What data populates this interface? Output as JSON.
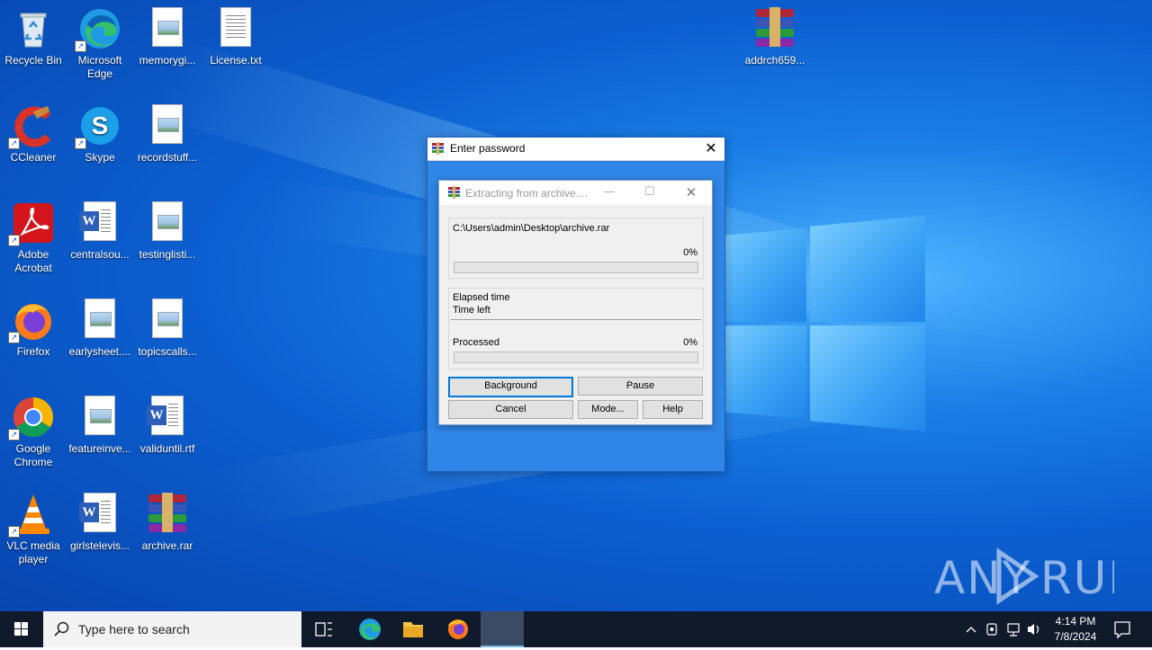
{
  "desktop": {
    "icons": [
      {
        "label": "Recycle Bin"
      },
      {
        "label": "Microsoft Edge"
      },
      {
        "label": "memorygi..."
      },
      {
        "label": "License.txt"
      },
      {
        "label": "addrch659..."
      },
      {
        "label": "CCleaner"
      },
      {
        "label": "Skype"
      },
      {
        "label": "recordstuff..."
      },
      {
        "label": "Adobe Acrobat"
      },
      {
        "label": "centralsou..."
      },
      {
        "label": "testinglisti..."
      },
      {
        "label": "Firefox"
      },
      {
        "label": "earlysheet...."
      },
      {
        "label": "topicscalls..."
      },
      {
        "label": "Google Chrome"
      },
      {
        "label": "featureinve..."
      },
      {
        "label": "validuntil.rtf"
      },
      {
        "label": "VLC media player"
      },
      {
        "label": "girlstelevis..."
      },
      {
        "label": "archive.rar"
      }
    ],
    "watermark": "ANY RUN"
  },
  "password_dialog": {
    "title": "Enter password",
    "close_glyph": "✕"
  },
  "extract_dialog": {
    "title": "Extracting from archive....",
    "minimize_glyph": "—",
    "maximize_glyph": "☐",
    "close_glyph": "✕",
    "path": "C:\\Users\\admin\\Desktop\\archive.rar",
    "file_percent": "0%",
    "file_progress": 0,
    "elapsed_label": "Elapsed time",
    "time_left_label": "Time left",
    "processed_label": "Processed",
    "processed_percent": "0%",
    "processed_progress": 0,
    "buttons": {
      "background": "Background",
      "pause": "Pause",
      "cancel": "Cancel",
      "mode": "Mode...",
      "help": "Help"
    }
  },
  "taskbar": {
    "search_placeholder": "Type here to search",
    "time": "4:14 PM",
    "date": "7/8/2024"
  }
}
